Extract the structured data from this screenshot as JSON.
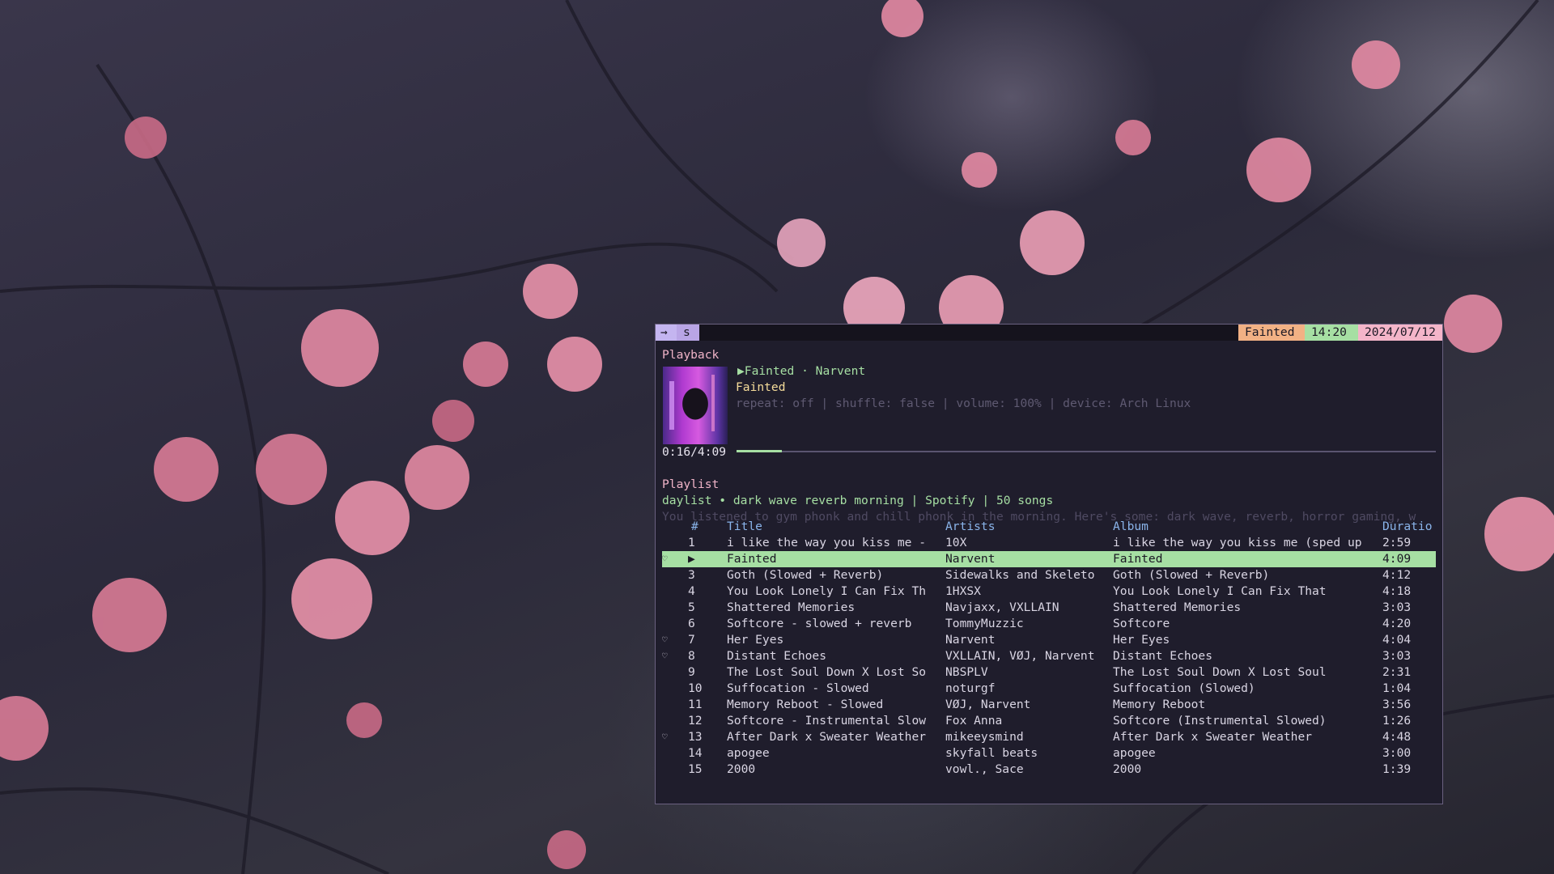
{
  "topbar": {
    "arrow": "→",
    "session": "s",
    "now_playing": "Fainted",
    "clock": "14:20",
    "date": "2024/07/12"
  },
  "playback": {
    "section_label": "Playback",
    "play_icon": "▶",
    "now_playing_line": "Fainted · Narvent",
    "album": "Fainted",
    "status_line": "repeat: off | shuffle: false | volume: 100% | device: Arch Linux",
    "position": "0:16/4:09",
    "progress_fraction": 0.065
  },
  "playlist": {
    "section_label": "Playlist",
    "title_line": "daylist • dark wave reverb morning | Spotify | 50 songs",
    "description": "You listened to gym phonk and chill phonk in the morning. Here's some: dark wave, reverb, horror gaming, w",
    "columns": {
      "num": "#",
      "title": "Title",
      "artists": "Artists",
      "album": "Album",
      "duration": "Duratio"
    },
    "tracks": [
      {
        "heart": "",
        "num": "1",
        "title": "i like the way you kiss me -",
        "artists": "10X",
        "album": "i like the way you kiss me (sped up",
        "duration": "2:59"
      },
      {
        "heart": "♡",
        "num": "▶",
        "title": "Fainted",
        "artists": "Narvent",
        "album": "Fainted",
        "duration": "4:09"
      },
      {
        "heart": "",
        "num": "3",
        "title": "Goth (Slowed + Reverb)",
        "artists": "Sidewalks and Skeleto",
        "album": "Goth (Slowed + Reverb)",
        "duration": "4:12"
      },
      {
        "heart": "",
        "num": "4",
        "title": "You Look Lonely I Can Fix Th",
        "artists": "1HXSX",
        "album": "You Look Lonely I Can Fix That",
        "duration": "4:18"
      },
      {
        "heart": "",
        "num": "5",
        "title": "Shattered Memories",
        "artists": "Navjaxx, VXLLAIN",
        "album": "Shattered Memories",
        "duration": "3:03"
      },
      {
        "heart": "",
        "num": "6",
        "title": "Softcore - slowed + reverb",
        "artists": "TommyMuzzic",
        "album": "Softcore",
        "duration": "4:20"
      },
      {
        "heart": "♡",
        "num": "7",
        "title": "Her Eyes",
        "artists": "Narvent",
        "album": "Her Eyes",
        "duration": "4:04"
      },
      {
        "heart": "♡",
        "num": "8",
        "title": "Distant Echoes",
        "artists": "VXLLAIN, VØJ, Narvent",
        "album": "Distant Echoes",
        "duration": "3:03"
      },
      {
        "heart": "",
        "num": "9",
        "title": "The Lost Soul Down X Lost So",
        "artists": "NBSPLV",
        "album": "The Lost Soul Down X Lost Soul",
        "duration": "2:31"
      },
      {
        "heart": "",
        "num": "10",
        "title": "Suffocation - Slowed",
        "artists": "noturgf",
        "album": "Suffocation (Slowed)",
        "duration": "1:04"
      },
      {
        "heart": "",
        "num": "11",
        "title": "Memory Reboot - Slowed",
        "artists": "VØJ, Narvent",
        "album": "Memory Reboot",
        "duration": "3:56"
      },
      {
        "heart": "",
        "num": "12",
        "title": "Softcore - Instrumental Slow",
        "artists": "Fox Anna",
        "album": "Softcore (Instrumental Slowed)",
        "duration": "1:26"
      },
      {
        "heart": "♡",
        "num": "13",
        "title": "After Dark x Sweater Weather",
        "artists": "mikeeysmind",
        "album": "After Dark x Sweater Weather",
        "duration": "4:48"
      },
      {
        "heart": "",
        "num": "14",
        "title": "apogee",
        "artists": "skyfall beats",
        "album": "apogee",
        "duration": "3:00"
      },
      {
        "heart": "",
        "num": "15",
        "title": "2000",
        "artists": "vowl., Sace",
        "album": "2000",
        "duration": "1:39"
      }
    ]
  },
  "colors": {
    "accent_green": "#a6dfa3",
    "accent_pink": "#f0b4c8",
    "accent_yellow": "#f5dc9a",
    "header_blue": "#8ab4ea",
    "terminal_bg": "#1f1d2c"
  }
}
